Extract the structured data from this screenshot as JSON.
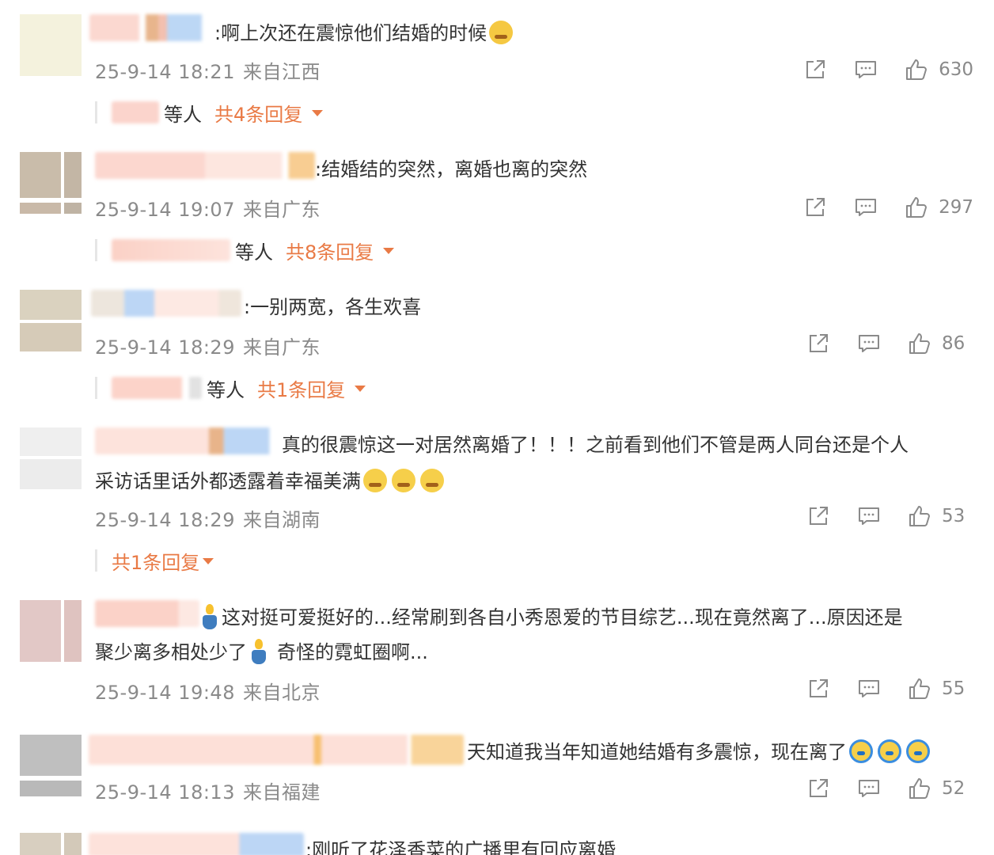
{
  "comments": [
    {
      "text": ":啊上次还在震惊他们结婚的时候",
      "time": "25-9-14 18:21",
      "location": "来自江西",
      "likes": "630",
      "reply_who": "等人",
      "reply_total": "共4条回复"
    },
    {
      "text": ":结婚结的突然，离婚也离的突然",
      "time": "25-9-14 19:07",
      "location": "来自广东",
      "likes": "297",
      "reply_who": "等人",
      "reply_total": "共8条回复"
    },
    {
      "text": ":一别两宽，各生欢喜",
      "time": "25-9-14 18:29",
      "location": "来自广东",
      "likes": "86",
      "reply_who": "等人",
      "reply_total": "共1条回复"
    },
    {
      "text_line1": "真的很震惊这一对居然离婚了！！！之前看到他们不管是两人同台还是个人",
      "text_line2": "采访话里话外都透露着幸福美满",
      "time": "25-9-14 18:29",
      "location": "来自湖南",
      "likes": "53",
      "reply_total": "共1条回复"
    },
    {
      "text_line1": "这对挺可爱挺好的...经常刷到各自小秀恩爱的节目综艺...现在竟然离了...原因还是",
      "text_line2a": "聚少离多相处少了",
      "text_line2b": "奇怪的霓虹圈啊...",
      "time": "25-9-14 19:48",
      "location": "来自北京",
      "likes": "55"
    },
    {
      "text": "天知道我当年知道她结婚有多震惊，现在离了",
      "time": "25-9-14 18:13",
      "location": "来自福建",
      "likes": "52"
    },
    {
      "text": ":刚听了花泽香菜的广播里有回应离婚"
    }
  ],
  "icons": [
    "share-icon",
    "comment-icon",
    "like-icon",
    "laugh-cry-emoji",
    "crying-emoji",
    "candle-emoji",
    "shocked-emoji"
  ],
  "colors": {
    "reply_accent": "#e97a45",
    "meta_gray": "#8a8a8a",
    "text": "#333333"
  }
}
